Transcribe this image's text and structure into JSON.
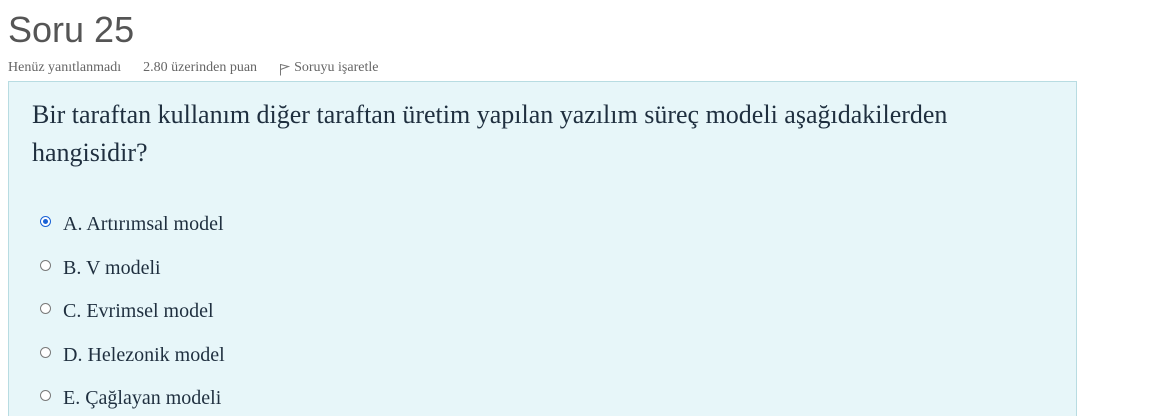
{
  "question": {
    "title": "Soru 25",
    "state": "Henüz yanıtlanmadı",
    "grade": "2.80 üzerinden puan",
    "flag_label": "Soruyu işaretle",
    "text": "Bir taraftan kullanım diğer taraftan üretim yapılan yazılım süreç modeli aşağıdakilerden hangisidir?",
    "selected_index": 0,
    "options": [
      {
        "label": "A. Artırımsal model"
      },
      {
        "label": "B. V modeli"
      },
      {
        "label": "C. Evrimsel model"
      },
      {
        "label": "D. Helezonik model"
      },
      {
        "label": "E. Çağlayan modeli"
      }
    ]
  },
  "colors": {
    "content_bg": "#e7f6f9",
    "selected_radio": "#1a62d6"
  },
  "icons": {
    "flag": "flag-icon"
  }
}
